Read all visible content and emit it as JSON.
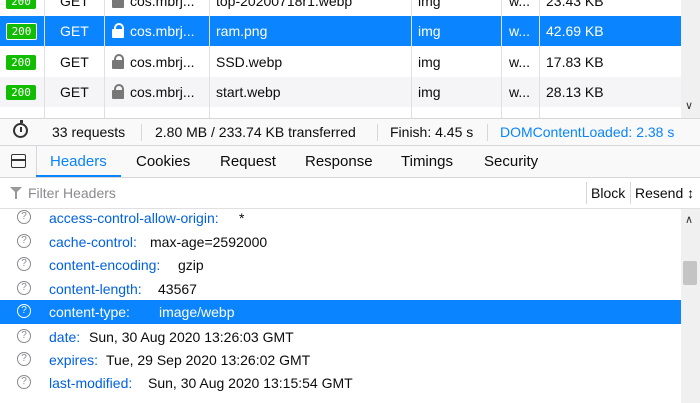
{
  "requests": [
    {
      "status": "200",
      "method": "GET",
      "domain": "cos.mbrj...",
      "file": "top-20200718r1.webp",
      "type": "img",
      "transferred": "w...",
      "size": "23.43 KB",
      "selected": false,
      "alt": false
    },
    {
      "status": "200",
      "method": "GET",
      "domain": "cos.mbrj...",
      "file": "ram.png",
      "type": "img",
      "transferred": "w...",
      "size": "42.69 KB",
      "selected": true,
      "alt": false
    },
    {
      "status": "200",
      "method": "GET",
      "domain": "cos.mbrj...",
      "file": "SSD.webp",
      "type": "img",
      "transferred": "w...",
      "size": "17.83 KB",
      "selected": false,
      "alt": false
    },
    {
      "status": "200",
      "method": "GET",
      "domain": "cos.mbrj...",
      "file": "start.webp",
      "type": "img",
      "transferred": "w...",
      "size": "28.13 KB",
      "selected": false,
      "alt": true
    }
  ],
  "summary": {
    "requests": "33 requests",
    "transferred": "2.80 MB / 233.74 KB transferred",
    "finish": "Finish: 4.45 s",
    "dom_content_loaded": "DOMContentLoaded: 2.38 s"
  },
  "tabs": [
    {
      "label": "Headers",
      "active": true
    },
    {
      "label": "Cookies",
      "active": false
    },
    {
      "label": "Request",
      "active": false
    },
    {
      "label": "Response",
      "active": false
    },
    {
      "label": "Timings",
      "active": false
    },
    {
      "label": "Security",
      "active": false
    }
  ],
  "filter": {
    "placeholder": "Filter Headers",
    "block_label": "Block",
    "resend_label": "Resend",
    "resend_arrow": "↕"
  },
  "headers": [
    {
      "name": "access-control-allow-origin:",
      "value": "*",
      "selected": false
    },
    {
      "name": "cache-control:",
      "value": "max-age=2592000",
      "selected": false
    },
    {
      "name": "content-encoding:",
      "value": "gzip",
      "selected": false
    },
    {
      "name": "content-length:",
      "value": "43567",
      "selected": false
    },
    {
      "name": "content-type:",
      "value": "image/webp",
      "selected": true
    },
    {
      "name": "date:",
      "value": "Sun, 30 Aug 2020 13:26:03 GMT",
      "selected": false
    },
    {
      "name": "expires:",
      "value": "Tue, 29 Sep 2020 13:26:02 GMT",
      "selected": false
    },
    {
      "name": "last-modified:",
      "value": "Sun, 30 Aug 2020 13:15:54 GMT",
      "selected": false
    }
  ],
  "colors": {
    "accent": "#0a84ff",
    "status_ok": "#12bc00",
    "header_name": "#0060df"
  },
  "icons": {
    "help": "?",
    "scroll_down": "∨",
    "scroll_up": "∧"
  }
}
